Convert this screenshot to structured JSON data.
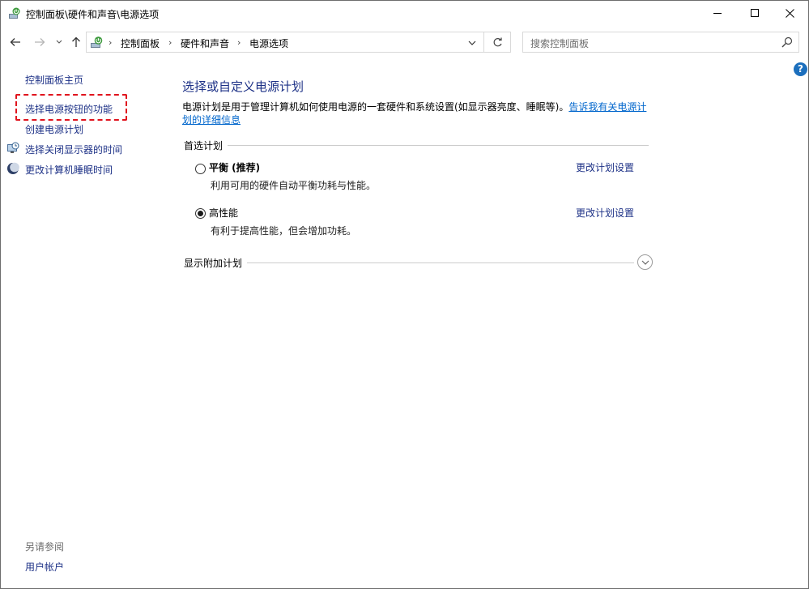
{
  "window": {
    "title": "控制面板\\硬件和声音\\电源选项"
  },
  "addressbar": {
    "crumbs": [
      "控制面板",
      "硬件和声音",
      "电源选项"
    ]
  },
  "search": {
    "placeholder": "搜索控制面板"
  },
  "sidebar": {
    "home_label": "控制面板主页",
    "items": [
      {
        "label": "选择电源按钮的功能",
        "icon": "none"
      },
      {
        "label": "创建电源计划",
        "icon": "none"
      },
      {
        "label": "选择关闭显示器的时间",
        "icon": "monitor-clock-icon"
      },
      {
        "label": "更改计算机睡眠时间",
        "icon": "moon-icon"
      }
    ],
    "see_also_label": "另请参阅",
    "see_also_items": [
      {
        "label": "用户帐户"
      }
    ]
  },
  "main": {
    "title": "选择或自定义电源计划",
    "description": "电源计划是用于管理计算机如何使用电源的一套硬件和系统设置(如显示器亮度、睡眠等)。",
    "description_link": "告诉我有关电源计划的详细信息",
    "preferred_section": "首选计划",
    "plans": [
      {
        "name": "平衡 (推荐)",
        "description": "利用可用的硬件自动平衡功耗与性能。",
        "change_link": "更改计划设置",
        "selected": false
      },
      {
        "name": "高性能",
        "description": "有利于提高性能，但会增加功耗。",
        "change_link": "更改计划设置",
        "selected": true
      }
    ],
    "additional_section": "显示附加计划"
  },
  "colors": {
    "link": "#1e3287",
    "hyperlink": "#0066cc",
    "highlight_box": "#e0141e",
    "help_icon": "#1c6fbd"
  }
}
